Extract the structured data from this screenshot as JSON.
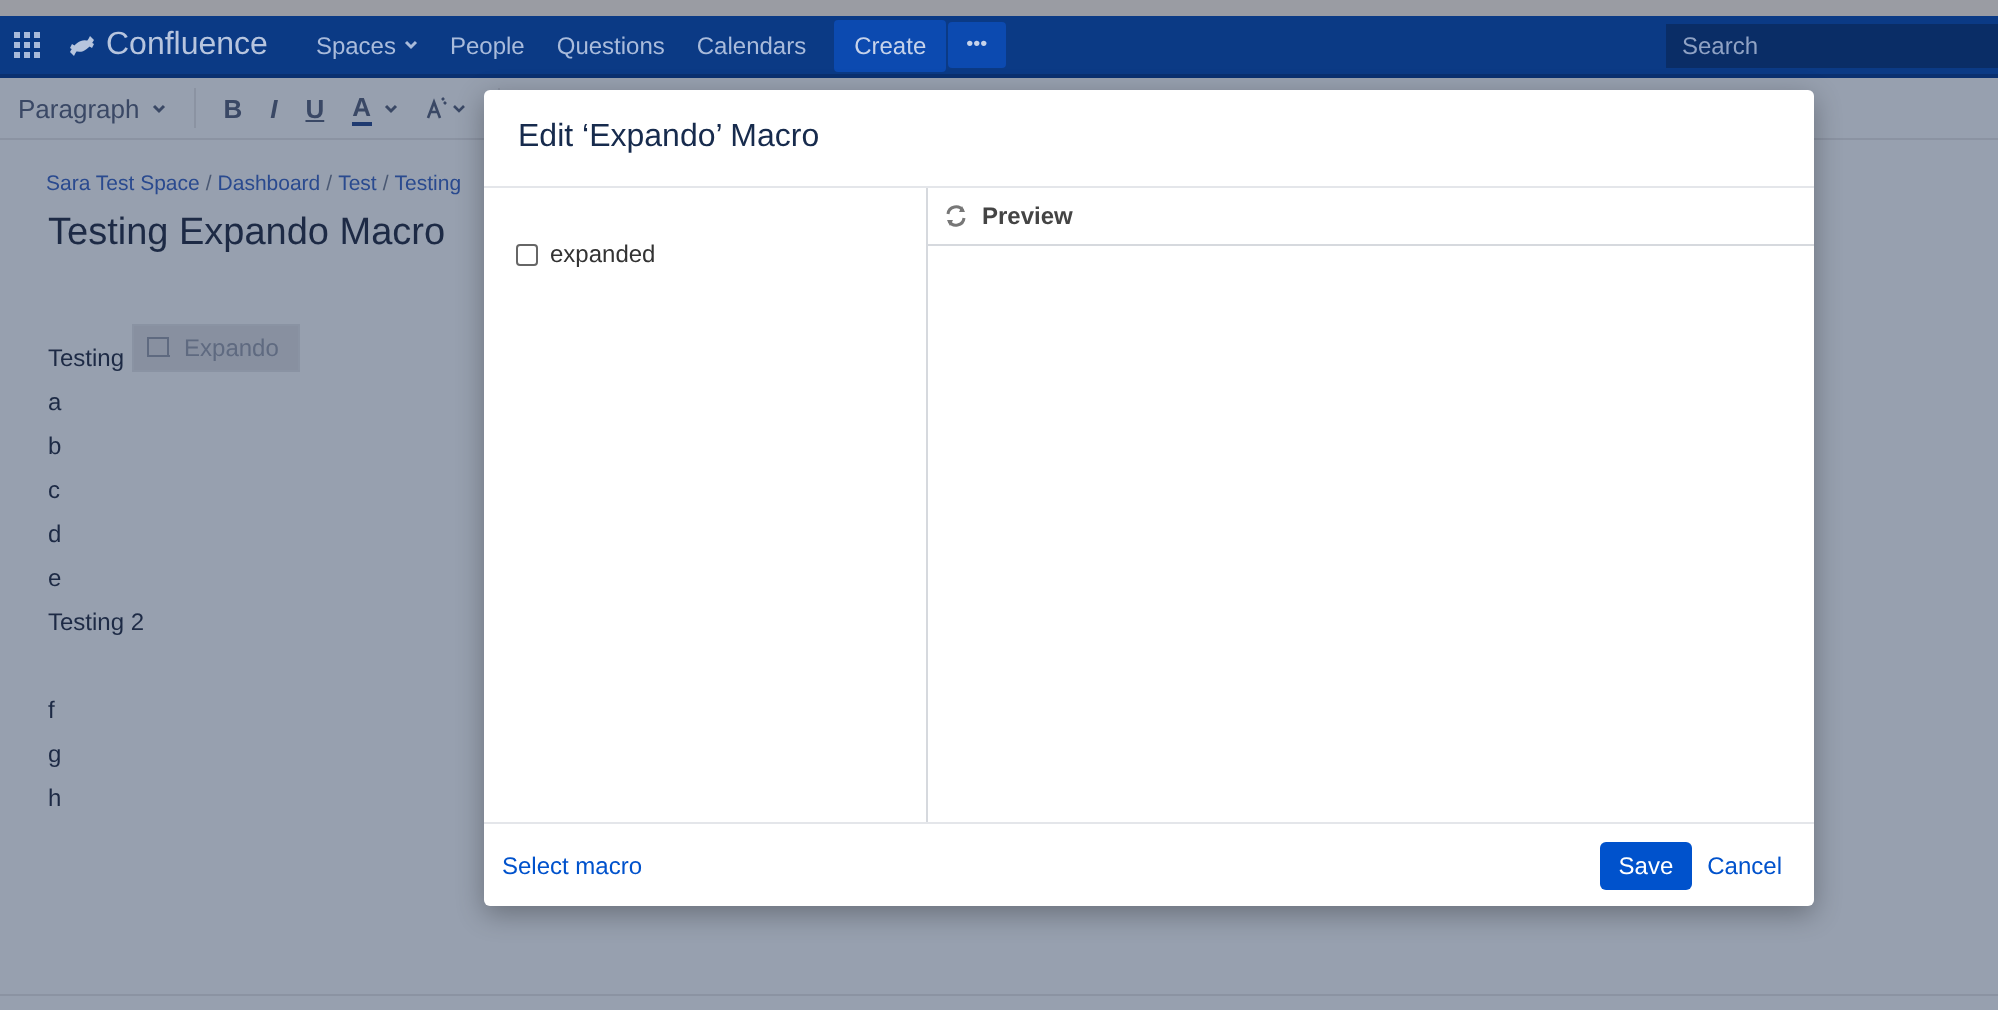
{
  "nav": {
    "logo": "Confluence",
    "items": [
      {
        "label": "Spaces",
        "dropdown": true
      },
      {
        "label": "People",
        "dropdown": false
      },
      {
        "label": "Questions",
        "dropdown": false
      },
      {
        "label": "Calendars",
        "dropdown": false
      }
    ],
    "create": "Create",
    "more": "•••",
    "search": {
      "placeholder": "Search"
    }
  },
  "toolbar": {
    "style": "Paragraph",
    "format": [
      "B",
      "I",
      "U"
    ],
    "text_color_button": "A"
  },
  "breadcrumbs": {
    "separator": "/",
    "items": [
      "Sara Test Space",
      "Dashboard",
      "Test",
      "Testing"
    ]
  },
  "title": "Testing Expando Macro",
  "content": [
    {
      "kind": "text",
      "text": "Testing",
      "macro": "Expando"
    },
    {
      "kind": "text",
      "text": "a"
    },
    {
      "kind": "text",
      "text": "b"
    },
    {
      "kind": "text",
      "text": "c"
    },
    {
      "kind": "text",
      "text": "d"
    },
    {
      "kind": "text",
      "text": "e"
    },
    {
      "kind": "text",
      "text": "Testing 2"
    },
    {
      "kind": "blank"
    },
    {
      "kind": "text",
      "text": "f"
    },
    {
      "kind": "text",
      "text": "g"
    },
    {
      "kind": "text",
      "text": "h"
    }
  ],
  "dialog": {
    "title": "Edit ‘Expando’ Macro",
    "params": [
      {
        "label": "expanded",
        "checked": false
      }
    ],
    "preview": "Preview",
    "select_macro": "Select macro",
    "save": "Save",
    "cancel": "Cancel"
  }
}
